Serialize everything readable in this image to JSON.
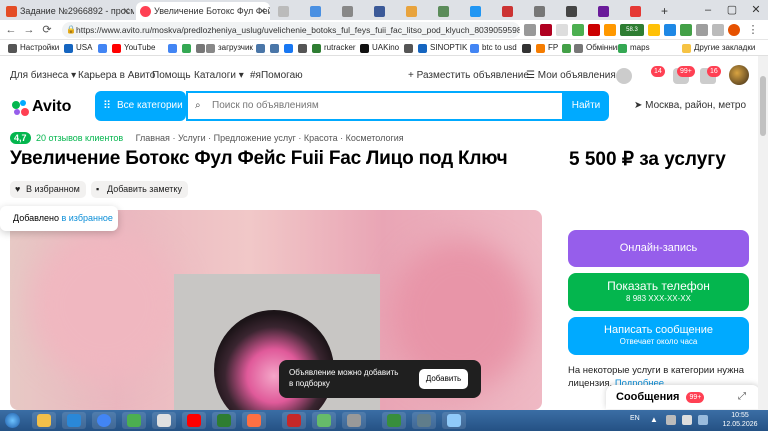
{
  "browser": {
    "tabs": [
      {
        "title": "Задание №2966892 - просмотр з",
        "active": false
      },
      {
        "title": "Увеличение Ботокс Фул Фейс Fu",
        "active": true
      }
    ],
    "url": "https://www.avito.ru/moskva/predlozheniya_uslug/uvelichenie_botoks_ful_feys_fuii_fac_litso_pod_klyuch_80390595987context...",
    "extension_badges": {
      "ltc": "LTC",
      "ltc_value": "58.3",
      "count": "81"
    },
    "bookmarks": [
      "Настройки",
      "USA",
      "YouTube",
      "загрузчик",
      "rutracker",
      "UAKino",
      "SINOPTIK",
      "btc to usd",
      "FP",
      "Обмінник",
      "maps"
    ],
    "bookmarks_other": "Другие закладки"
  },
  "topnav": {
    "for_business": "Для бизнеса",
    "career": "Карьера в Авито",
    "help": "Помощь",
    "catalogs": "Каталоги",
    "hashtag": "#яПомогаю",
    "post_ad": "Разместить объявление",
    "my_ads": "Мои объявления",
    "badges": {
      "favorites": "14",
      "messages": "99+",
      "cart": "16"
    }
  },
  "search": {
    "logo": "Avito",
    "categories_button": "Все категории",
    "placeholder": "Поиск по объявлениям",
    "find_button": "Найти",
    "location": "Москва, район, метро"
  },
  "breadcrumb": {
    "rating": "4,7",
    "reviews": "20 отзывов клиентов",
    "items": [
      "Главная",
      "Услуги",
      "Предложение услуг",
      "Красота",
      "Косметология"
    ]
  },
  "listing": {
    "title": "Увеличение Ботокс Фул Фейс Fuii Fac Лицо под Ключ",
    "price": "5 500 ₽ за услугу",
    "favorite_button": "В избранном",
    "note_button": "Добавить заметку"
  },
  "fav_toast": {
    "text": "Добавлено",
    "link": "в избранное"
  },
  "actions": {
    "book": "Онлайн-запись",
    "phone": "Показать телефон",
    "phone_sub": "8 983 XXX-XX-XX",
    "message": "Написать сообщение",
    "message_sub": "Отвечает около часа",
    "license_text": "На некоторые услуги в категории нужна лицензия.",
    "license_link": "Подробнее"
  },
  "collection_toast": {
    "text_line1": "Объявление можно добавить",
    "text_line2": "в подборку",
    "button": "Добавить"
  },
  "messages_panel": {
    "label": "Сообщения",
    "badge": "99+"
  },
  "taskbar": {
    "lang": "EN",
    "time": "10:55",
    "date": "12.05.2026"
  },
  "colors": {
    "avito_blue": "#00aaff",
    "book_purple": "#965eeb",
    "phone_green": "#04b64e",
    "message_blue": "#00aaff",
    "badge_red": "#ff4053"
  }
}
